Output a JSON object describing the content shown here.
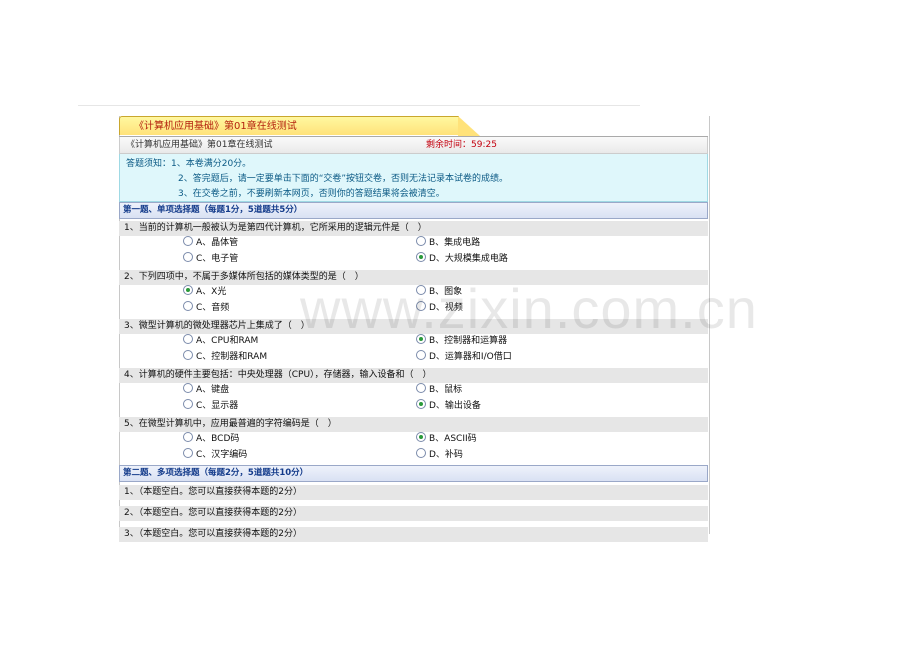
{
  "tab_title": "《计算机应用基础》第01章在线测试",
  "header": {
    "title": "《计算机应用基础》第01章在线测试",
    "remaining_label": "剩余时间：59:25"
  },
  "notice": {
    "lines": [
      "答题须知：1、本卷满分20分。",
      "2、答完题后，请一定要单击下面的“交卷”按钮交卷，否则无法记录本试卷的成绩。",
      "3、在交卷之前，不要刷新本网页，否则你的答题结果将会被清空。"
    ]
  },
  "section1": {
    "title": "第一题、单项选择题（每题1分，5道题共5分）",
    "questions": [
      {
        "text": "1、当前的计算机一般被认为是第四代计算机，它所采用的逻辑元件是（　）",
        "options": [
          "A、晶体管",
          "B、集成电路",
          "C、电子管",
          "D、大规模集成电路"
        ],
        "selected": 3
      },
      {
        "text": "2、下列四项中，不属于多媒体所包括的媒体类型的是（　）",
        "options": [
          "A、X光",
          "B、图象",
          "C、音频",
          "D、视频"
        ],
        "selected": 0
      },
      {
        "text": "3、微型计算机的微处理器芯片上集成了（　）",
        "options": [
          "A、CPU和RAM",
          "B、控制器和运算器",
          "C、控制器和RAM",
          "D、运算器和I/O借口"
        ],
        "selected": 1
      },
      {
        "text": "4、计算机的硬件主要包括：中央处理器（CPU），存储器，输入设备和（　）",
        "options": [
          "A、键盘",
          "B、鼠标",
          "C、显示器",
          "D、输出设备"
        ],
        "selected": 3
      },
      {
        "text": "5、在微型计算机中，应用最普遍的字符编码是（　）",
        "options": [
          "A、BCD码",
          "B、ASCII码",
          "C、汉字编码",
          "D、补码"
        ],
        "selected": 1
      }
    ]
  },
  "section2": {
    "title": "第二题、多项选择题（每题2分，5道题共10分）",
    "questions": [
      "1、（本题空白。您可以直接获得本题的2分）",
      "2、（本题空白。您可以直接获得本题的2分）",
      "3、（本题空白。您可以直接获得本题的2分）"
    ]
  },
  "watermark": "www.zixin.com.cn"
}
